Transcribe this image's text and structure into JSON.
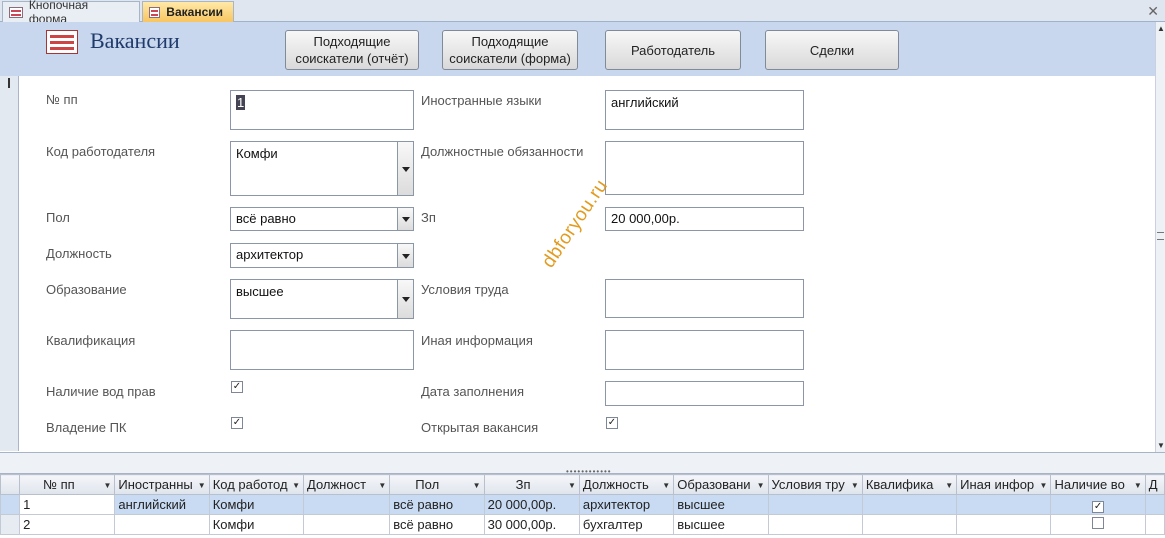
{
  "tabs": [
    {
      "label": "Кнопочная форма"
    },
    {
      "label": "Вакансии"
    }
  ],
  "header": {
    "title": "Вакансии",
    "buttons": [
      {
        "label": "Подходящие соискатели (отчёт)"
      },
      {
        "label": "Подходящие соискатели (форма)"
      },
      {
        "label": "Работодатель"
      },
      {
        "label": "Сделки"
      }
    ]
  },
  "form": {
    "num_label": "№ пп",
    "num_value": "1",
    "employer_label": "Код работодателя",
    "employer_value": "Комфи",
    "gender_label": "Пол",
    "gender_value": "всё равно",
    "position_label": "Должность",
    "position_value": "архитектор",
    "education_label": "Образование",
    "education_value": "высшее",
    "qualification_label": "Квалификация",
    "qualification_value": "",
    "license_label": "Наличие вод прав",
    "license_checked": true,
    "pc_label": "Владение ПК",
    "pc_checked": true,
    "languages_label": "Иностранные языки",
    "languages_value": "английский",
    "duties_label": "Должностные обязанности",
    "duties_value": "",
    "salary_label": "Зп",
    "salary_value": "20 000,00р.",
    "conditions_label": "Условия труда",
    "conditions_value": "",
    "other_label": "Иная  информация",
    "other_value": "",
    "date_label": "Дата заполнения",
    "date_value": "",
    "open_label": "Открытая вакансия",
    "open_checked": true
  },
  "watermark": "dbforyou.ru",
  "grid": {
    "columns": [
      "№ пп",
      "Иностранны",
      "Код работод",
      "Должност",
      "Пол",
      "Зп",
      "Должность",
      "Образовани",
      "Условия тру",
      "Квалифика",
      "Иная  инфор",
      "Наличие во",
      "Д"
    ],
    "rows": [
      [
        "1",
        "английский",
        "Комфи",
        "",
        "всё равно",
        "20 000,00р.",
        "архитектор",
        "высшее",
        "",
        "",
        "",
        true,
        ""
      ],
      [
        "2",
        "",
        "Комфи",
        "",
        "всё равно",
        "30 000,00р.",
        "бухгалтер",
        "высшее",
        "",
        "",
        "",
        false,
        ""
      ]
    ]
  }
}
